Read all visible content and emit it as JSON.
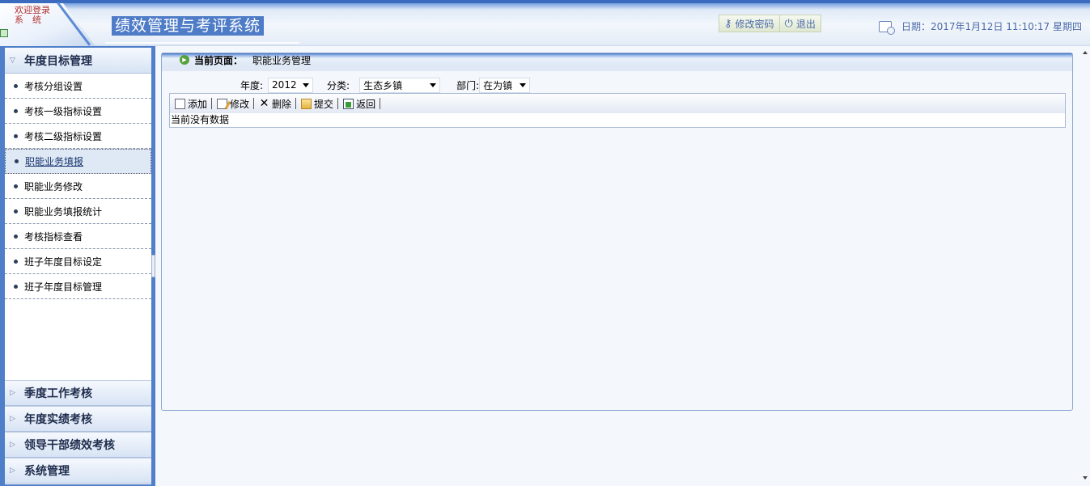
{
  "header": {
    "welcome_line1": "欢迎登录",
    "welcome_line2": "系　统",
    "system_title": "绩效管理与考评系统",
    "change_password_label": "修改密码",
    "logout_label": "退出",
    "date_text": "日期：2017年1月12日  11:10:17 星期四"
  },
  "sidebar": {
    "group_annual_target": "年度目标管理",
    "items": [
      {
        "label": "考核分组设置"
      },
      {
        "label": "考核一级指标设置"
      },
      {
        "label": "考核二级指标设置"
      },
      {
        "label": "职能业务填报"
      },
      {
        "label": "职能业务修改"
      },
      {
        "label": "职能业务填报统计"
      },
      {
        "label": "考核指标查看"
      },
      {
        "label": "班子年度目标设定"
      },
      {
        "label": "班子年度目标管理"
      }
    ],
    "active_item": "职能业务填报",
    "bottom_groups": [
      {
        "label": "季度工作考核"
      },
      {
        "label": "年度实绩考核"
      },
      {
        "label": "领导干部绩效考核"
      },
      {
        "label": "系统管理"
      }
    ]
  },
  "main": {
    "current_page_label": "当前页面：",
    "current_page_value": "职能业务管理",
    "filters": {
      "year_label": "年度:",
      "year_value": "2012",
      "category_label": "分类:",
      "category_value": "生态乡镇",
      "dept_label": "部门:",
      "dept_value": "在为镇"
    },
    "toolbar": {
      "add_label": "添加",
      "edit_label": "修改",
      "delete_label": "删除",
      "submit_label": "提交",
      "back_label": "返回"
    },
    "empty_message": "当前没有数据"
  },
  "colors": {
    "accent_blue": "#4f7fc9",
    "header_title_bg": "#4f7cc7"
  }
}
